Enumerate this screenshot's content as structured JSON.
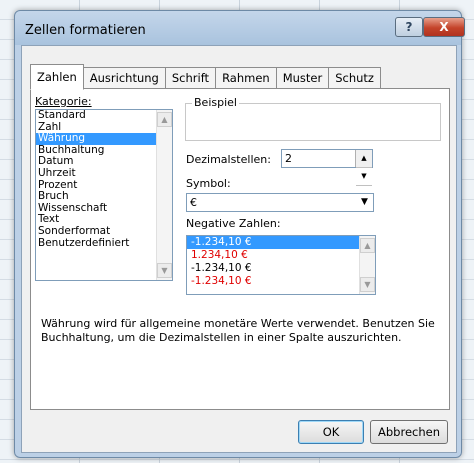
{
  "window": {
    "title": "Zellen formatieren"
  },
  "titlebar": {
    "help_label": "?",
    "close_label": "X"
  },
  "tabs": [
    {
      "label": "Zahlen",
      "active": true
    },
    {
      "label": "Ausrichtung",
      "active": false
    },
    {
      "label": "Schrift",
      "active": false
    },
    {
      "label": "Rahmen",
      "active": false
    },
    {
      "label": "Muster",
      "active": false
    },
    {
      "label": "Schutz",
      "active": false
    }
  ],
  "kategorie": {
    "label": "Kategorie:",
    "items": [
      "Standard",
      "Zahl",
      "Währung",
      "Buchhaltung",
      "Datum",
      "Uhrzeit",
      "Prozent",
      "Bruch",
      "Wissenschaft",
      "Text",
      "Sonderformat",
      "Benutzerdefiniert"
    ],
    "selected": "Währung"
  },
  "beispiel": {
    "label": "Beispiel",
    "value": ""
  },
  "dezimalstellen": {
    "label": "Dezimalstellen:",
    "value": "2"
  },
  "symbol": {
    "label": "Symbol:",
    "value": "€"
  },
  "negative": {
    "label": "Negative Zahlen:",
    "items": [
      {
        "text": "-1.234,10 €",
        "red": false,
        "selected": true
      },
      {
        "text": "1.234,10 €",
        "red": true,
        "selected": false
      },
      {
        "text": "-1.234,10 €",
        "red": false,
        "selected": false
      },
      {
        "text": "-1.234,10 €",
        "red": true,
        "selected": false
      }
    ]
  },
  "description": "Währung wird für allgemeine monetäre Werte verwendet. Benutzen Sie Buchhaltung, um die Dezimalstellen in einer Spalte auszurichten.",
  "buttons": {
    "ok": "OK",
    "cancel": "Abbrechen"
  },
  "colors": {
    "selection": "#3399ff",
    "negative_red": "#e00000",
    "close_button": "#c4432a"
  }
}
